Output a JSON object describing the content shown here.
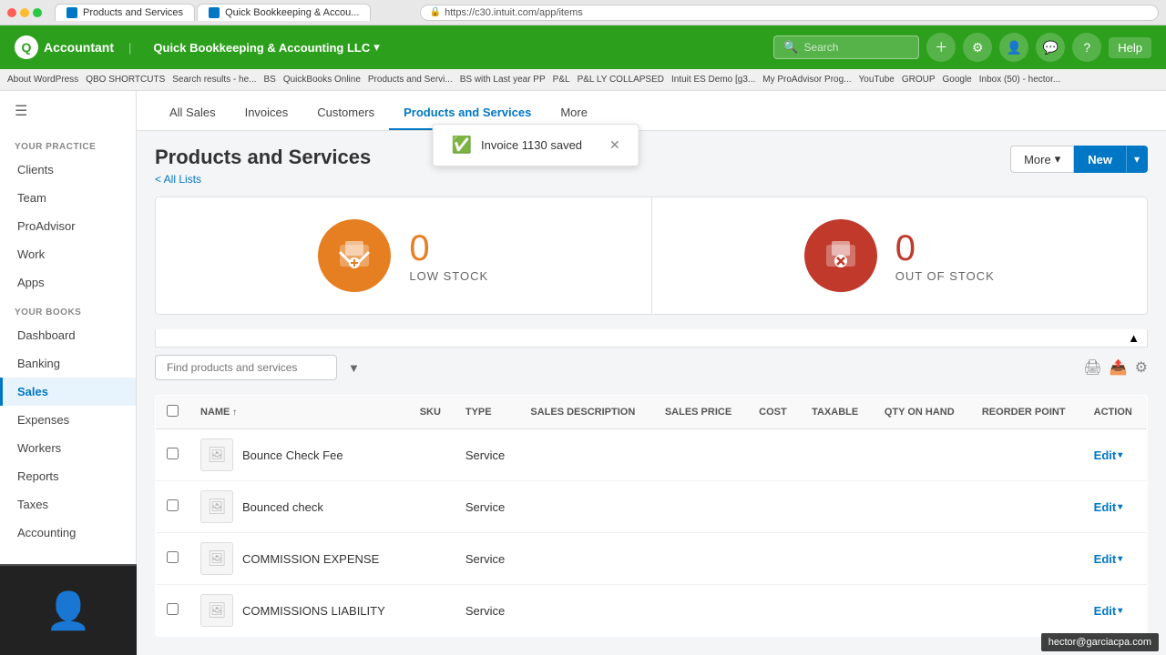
{
  "browser": {
    "dots": [
      "red",
      "yellow",
      "green"
    ],
    "tabs": [
      {
        "label": "Products and Services",
        "active": true
      },
      {
        "label": "Quick Bookkeeping & Accou...",
        "active": false
      }
    ],
    "address": "https://c30.intuit.com/app/items",
    "lock_label": "Secure"
  },
  "bookmarks": [
    "About WordPress",
    "QBO SHORTCUTS",
    "Search results - he...",
    "BS",
    "QuickBooks Online",
    "Products and Servi...",
    "BS with Last year PP",
    "P&L",
    "P&L LY COLLAPSED",
    "Intuit ES Demo [g3...",
    "My ProAdvisor Prog...",
    "YouTube",
    "GROUP",
    "Google",
    "Inbox (50) - hector..."
  ],
  "header": {
    "logo_letter": "Q",
    "app_name": "Accountant",
    "company_name": "Quick Bookkeeping & Accounting LLC",
    "search_placeholder": "Search",
    "help_label": "Help"
  },
  "sidebar": {
    "hamburger_icon": "☰",
    "your_practice_label": "YOUR PRACTICE",
    "practice_items": [
      {
        "label": "Clients",
        "active": false
      },
      {
        "label": "Team",
        "active": false
      },
      {
        "label": "ProAdvisor",
        "active": false
      },
      {
        "label": "Work",
        "active": false
      },
      {
        "label": "Apps",
        "active": false
      }
    ],
    "your_books_label": "YOUR BOOKS",
    "books_items": [
      {
        "label": "Dashboard",
        "active": false
      },
      {
        "label": "Banking",
        "active": false
      },
      {
        "label": "Sales",
        "active": true
      },
      {
        "label": "Expenses",
        "active": false
      },
      {
        "label": "Workers",
        "active": false
      },
      {
        "label": "Reports",
        "active": false
      },
      {
        "label": "Taxes",
        "active": false
      },
      {
        "label": "Accounting",
        "active": false
      }
    ]
  },
  "tabs": [
    {
      "label": "All Sales",
      "active": false
    },
    {
      "label": "Invoices",
      "active": false
    },
    {
      "label": "Customers",
      "active": false
    },
    {
      "label": "Products and Services",
      "active": true
    },
    {
      "label": "More",
      "active": false
    }
  ],
  "toast": {
    "message": "Invoice 1130 saved",
    "close_icon": "✕"
  },
  "page": {
    "title": "Products and Services",
    "breadcrumb": "< All Lists",
    "more_button": "More",
    "new_button": "New"
  },
  "stock": {
    "low_stock": {
      "count": "0",
      "label": "LOW STOCK"
    },
    "out_of_stock": {
      "count": "0",
      "label": "OUT OF STOCK"
    }
  },
  "table": {
    "search_placeholder": "Find products and services",
    "columns": [
      "NAME",
      "SKU",
      "TYPE",
      "SALES DESCRIPTION",
      "SALES PRICE",
      "COST",
      "TAXABLE",
      "QTY ON HAND",
      "REORDER POINT",
      "ACTION"
    ],
    "rows": [
      {
        "name": "Bounce Check Fee",
        "sku": "",
        "type": "Service",
        "sales_desc": "",
        "sales_price": "",
        "cost": "",
        "taxable": "",
        "qty_on_hand": "",
        "reorder_point": ""
      },
      {
        "name": "Bounced check",
        "sku": "",
        "type": "Service",
        "sales_desc": "",
        "sales_price": "",
        "cost": "",
        "taxable": "",
        "qty_on_hand": "",
        "reorder_point": ""
      },
      {
        "name": "COMMISSION EXPENSE",
        "sku": "",
        "type": "Service",
        "sales_desc": "",
        "sales_price": "",
        "cost": "",
        "taxable": "",
        "qty_on_hand": "",
        "reorder_point": ""
      },
      {
        "name": "COMMISSIONS LIABILITY",
        "sku": "",
        "type": "Service",
        "sales_desc": "",
        "sales_price": "",
        "cost": "",
        "taxable": "",
        "qty_on_hand": "",
        "reorder_point": ""
      }
    ],
    "edit_label": "Edit"
  },
  "user": {
    "email": "hector@garciacpa.com"
  }
}
